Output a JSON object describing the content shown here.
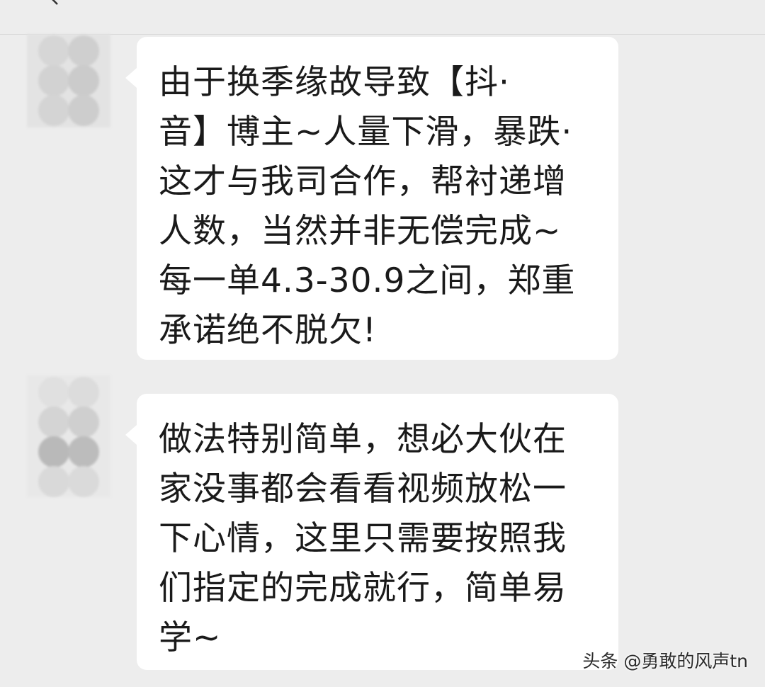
{
  "header": {
    "back_icon": "chevron-left-icon"
  },
  "colors": {
    "background": "#ededed",
    "bubble": "#ffffff",
    "text": "#1a1a1a"
  },
  "messages": [
    {
      "sender": "contact",
      "lines": [
        "由于换季缘故导致【抖·",
        "音】博主~人量下滑，暴跌·",
        "这才与我司合作，帮衬递增",
        "人数，当然并非无偿完成~",
        "每一单4.3-30.9之间，郑重",
        "承诺绝不脱欠!"
      ]
    },
    {
      "sender": "contact",
      "lines": [
        "做法特别简单，想必大伙在",
        "家没事都会看看视频放松一",
        "下心情，这里只需要按照我",
        "们指定的完成就行，简单易",
        "学~"
      ]
    }
  ],
  "watermark": {
    "text": "头条 @勇敢的风声tn"
  }
}
